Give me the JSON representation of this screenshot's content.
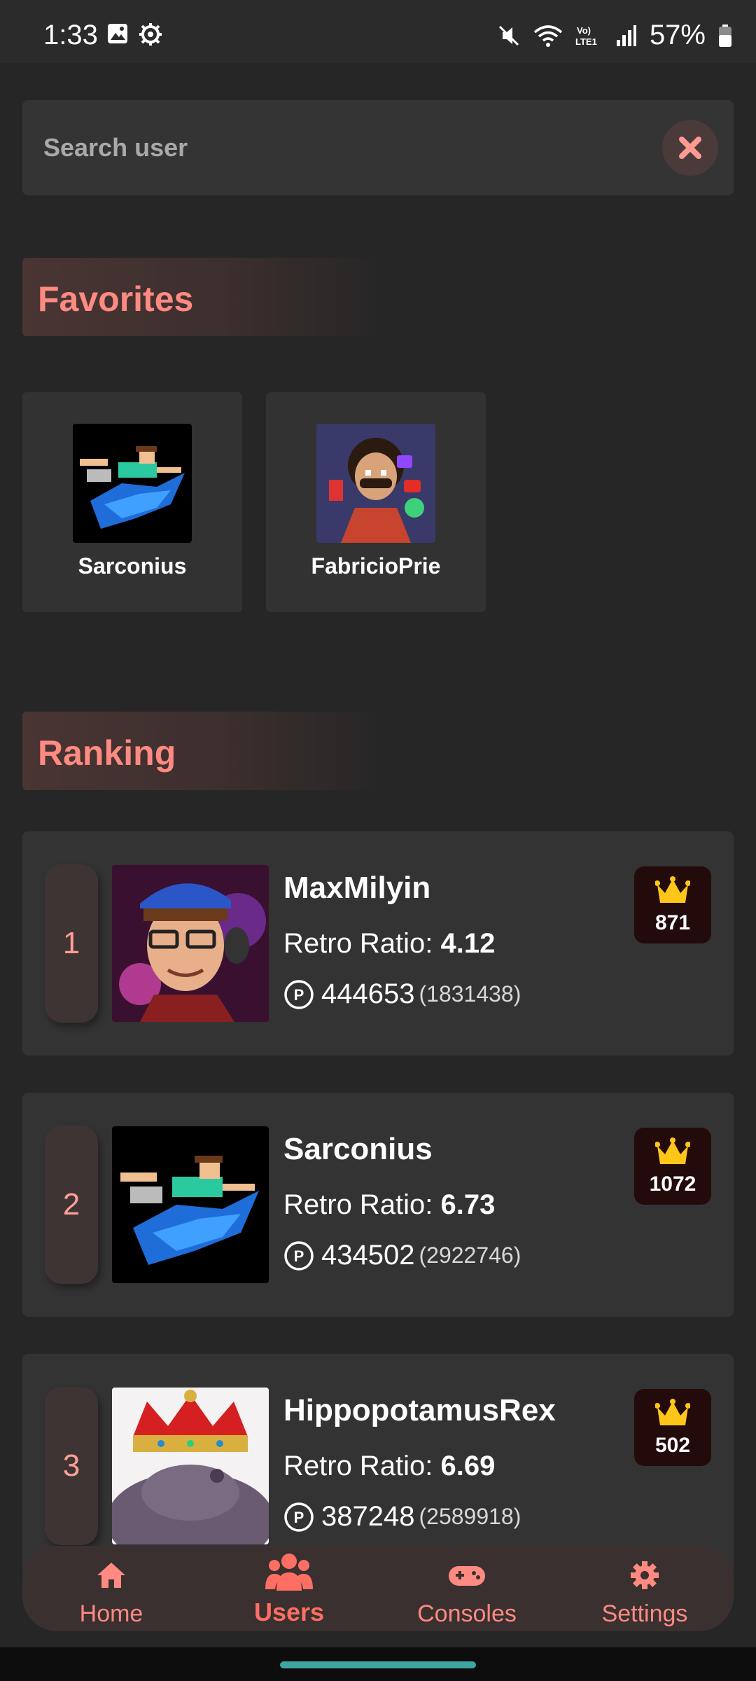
{
  "status_bar": {
    "time": "1:33",
    "battery": "57%"
  },
  "search": {
    "placeholder": "Search user",
    "value": ""
  },
  "favorites": {
    "title": "Favorites",
    "items": [
      {
        "name": "Sarconius"
      },
      {
        "name": "FabricioPrie"
      }
    ]
  },
  "ranking": {
    "title": "Ranking",
    "retro_ratio_label": "Retro Ratio:",
    "items": [
      {
        "position": "1",
        "name": "MaxMilyin",
        "retro_ratio": "4.12",
        "points": "444653",
        "total_points": "(1831438)",
        "mastered": "871"
      },
      {
        "position": "2",
        "name": "Sarconius",
        "retro_ratio": "6.73",
        "points": "434502",
        "total_points": "(2922746)",
        "mastered": "1072"
      },
      {
        "position": "3",
        "name": "HippopotamusRex",
        "retro_ratio": "6.69",
        "points": "387248",
        "total_points": "(2589918)",
        "mastered": "502"
      }
    ]
  },
  "nav": {
    "items": [
      {
        "label": "Home",
        "icon": "home-icon"
      },
      {
        "label": "Users",
        "icon": "users-icon",
        "active": true
      },
      {
        "label": "Consoles",
        "icon": "gamepad-icon"
      },
      {
        "label": "Settings",
        "icon": "gear-icon"
      }
    ]
  },
  "colors": {
    "accent": "#ff8a82",
    "background": "#262626",
    "card": "#333333",
    "crown": "#ffc61a"
  }
}
